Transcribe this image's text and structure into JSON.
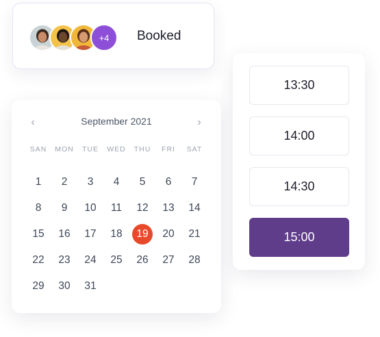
{
  "booked": {
    "avatars": [
      {
        "icon": "person-avatar-1",
        "bg": "#c9d3d6",
        "skin": "#c98c68",
        "hair": "#3a2a20",
        "shirt": "#e9e5de"
      },
      {
        "icon": "person-avatar-2",
        "bg": "#f3c24a",
        "skin": "#6b4630",
        "hair": "#1e1512",
        "shirt": "#e3e0d9"
      },
      {
        "icon": "person-avatar-3",
        "bg": "#f0b73a",
        "skin": "#d79b74",
        "hair": "#5a2e1a",
        "shirt": "#c65a3a"
      }
    ],
    "more_label": "+4",
    "more_color": "#8e4fd8",
    "label": "Booked"
  },
  "calendar": {
    "month_label": "September 2021",
    "prev_icon": "chevron-left-icon",
    "next_icon": "chevron-right-icon",
    "weekdays": [
      "SAN",
      "MON",
      "TUE",
      "WED",
      "THU",
      "FRI",
      "SAT"
    ],
    "weeks": [
      [
        "1",
        "2",
        "3",
        "4",
        "5",
        "6",
        "7"
      ],
      [
        "8",
        "9",
        "10",
        "11",
        "12",
        "13",
        "14"
      ],
      [
        "15",
        "16",
        "17",
        "18",
        "19",
        "20",
        "21"
      ],
      [
        "22",
        "23",
        "24",
        "25",
        "26",
        "27",
        "28"
      ],
      [
        "29",
        "30",
        "31"
      ]
    ],
    "selected_day": "19",
    "selected_color": "#e8492a"
  },
  "time_slots": {
    "slots": [
      "13:30",
      "14:00",
      "14:30",
      "15:00"
    ],
    "selected": "15:00",
    "selected_color": "#5f3d8b"
  }
}
